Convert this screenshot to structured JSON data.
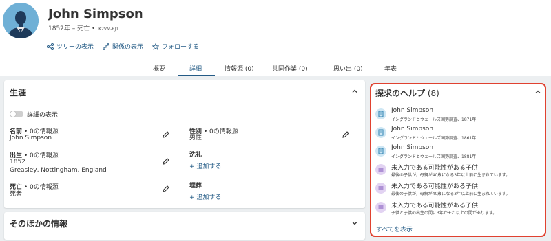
{
  "person": {
    "name": "John Simpson",
    "dates": "1852年 – 死亡 • ",
    "pid": "K2VM-RJ1"
  },
  "actions": [
    {
      "label": "ツリーの表示",
      "icon": "tree-icon"
    },
    {
      "label": "関係の表示",
      "icon": "relationship-icon"
    },
    {
      "label": "フォローする",
      "icon": "star-icon"
    }
  ],
  "tabs": [
    {
      "label": "概要"
    },
    {
      "label": "詳細"
    },
    {
      "label": "情報源 (0)"
    },
    {
      "label": "共同作業 (0)"
    },
    {
      "label": "思い出 (0)"
    },
    {
      "label": "年表"
    }
  ],
  "life": {
    "title": "生涯",
    "toggle_label": "詳細の表示",
    "name_label": "名前",
    "name_sources": " • 0の情報源",
    "name_value": "John Simpson",
    "sex_label": "性別",
    "sex_sources": " • 0の情報源",
    "sex_value": "男性",
    "birth_label": "出生",
    "birth_sources": " • 0の情報源",
    "birth_date": "1852",
    "birth_place": "Greasley, Nottingham, England",
    "christening_label": "洗礼",
    "christening_add": "+ 追加する",
    "death_label": "死亡",
    "death_sources": " • 0の情報源",
    "death_value": "死者",
    "burial_label": "埋葬",
    "burial_add": "+ 追加する"
  },
  "other": {
    "title": "そのほかの情報"
  },
  "help": {
    "title": "探求のヘルプ",
    "count": " (8)",
    "items": [
      {
        "title": "John Simpson",
        "sub": "イングランドとウェールズ国勢調査、1871年",
        "icon": "record-icon"
      },
      {
        "title": "John Simpson",
        "sub": "イングランドとウェールズ国勢調査、1861年",
        "icon": "record-icon"
      },
      {
        "title": "John Simpson",
        "sub": "イングランドとウェールズ国勢調査、1881年",
        "icon": "record-icon"
      },
      {
        "title": "未入力である可能性がある子供",
        "sub": "最後の子供が，母親が40歳になる3年以上前に生まれています。",
        "icon": "child-icon"
      },
      {
        "title": "未入力である可能性がある子供",
        "sub": "最後の子供が，母親が40歳になる3年以上前に生まれています。",
        "icon": "child-icon"
      },
      {
        "title": "未入力である可能性がある子供",
        "sub": "子供と子供の出生の間に3年かそれ以上の間があります。",
        "icon": "child-icon"
      }
    ],
    "show_all": "すべてを表示"
  },
  "colors": {
    "link": "#245b86",
    "highlight_border": "#e04230",
    "avatar_bg": "#6fb0d6",
    "page_bg": "#eceff1"
  }
}
